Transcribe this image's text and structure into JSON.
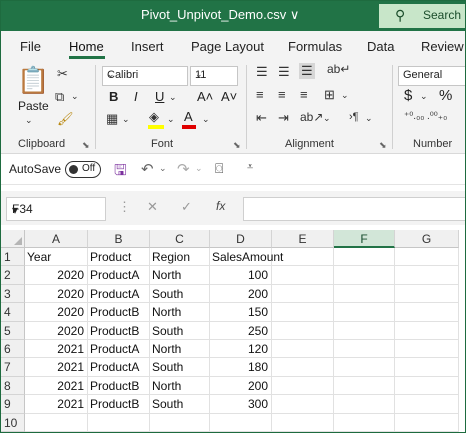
{
  "window": {
    "title": "Pivot_Unpivot_Demo.csv ∨",
    "search_label": "Search"
  },
  "tabs": [
    "File",
    "Home",
    "Insert",
    "Page Layout",
    "Formulas",
    "Data",
    "Review"
  ],
  "active_tab": "Home",
  "ribbon": {
    "clipboard": {
      "label": "Clipboard",
      "paste_label": "Paste"
    },
    "font": {
      "label": "Font",
      "font_name": "Calibri",
      "font_size": "11",
      "bold": "B",
      "italic": "I",
      "underline": "U",
      "grow": "A˄",
      "shrink": "A˅",
      "font_color_letter": "A"
    },
    "alignment": {
      "label": "Alignment"
    },
    "number": {
      "label": "Number",
      "format": "General",
      "currency": "$",
      "percent": "%"
    }
  },
  "qat": {
    "autosave_label": "AutoSave",
    "toggle_state": "Off"
  },
  "formula_bar": {
    "name_box": "F34",
    "fx": "fx",
    "formula": ""
  },
  "columns": [
    "A",
    "B",
    "C",
    "D",
    "E",
    "F",
    "G"
  ],
  "selected_column": "F",
  "rows": [
    [
      "Year",
      "Product",
      "Region",
      "SalesAmount",
      "",
      "",
      ""
    ],
    [
      "2020",
      "ProductA",
      "North",
      "100",
      "",
      "",
      ""
    ],
    [
      "2020",
      "ProductA",
      "South",
      "200",
      "",
      "",
      ""
    ],
    [
      "2020",
      "ProductB",
      "North",
      "150",
      "",
      "",
      ""
    ],
    [
      "2020",
      "ProductB",
      "South",
      "250",
      "",
      "",
      ""
    ],
    [
      "2021",
      "ProductA",
      "North",
      "120",
      "",
      "",
      ""
    ],
    [
      "2021",
      "ProductA",
      "South",
      "180",
      "",
      "",
      ""
    ],
    [
      "2021",
      "ProductB",
      "North",
      "200",
      "",
      "",
      ""
    ],
    [
      "2021",
      "ProductB",
      "South",
      "300",
      "",
      "",
      ""
    ],
    [
      "",
      "",
      "",
      "",
      "",
      "",
      ""
    ]
  ],
  "row_numbers": [
    "1",
    "2",
    "3",
    "4",
    "5",
    "6",
    "7",
    "8",
    "9",
    "10"
  ],
  "colors": {
    "accent": "#217346",
    "selected_header": "#d2e6d8"
  }
}
